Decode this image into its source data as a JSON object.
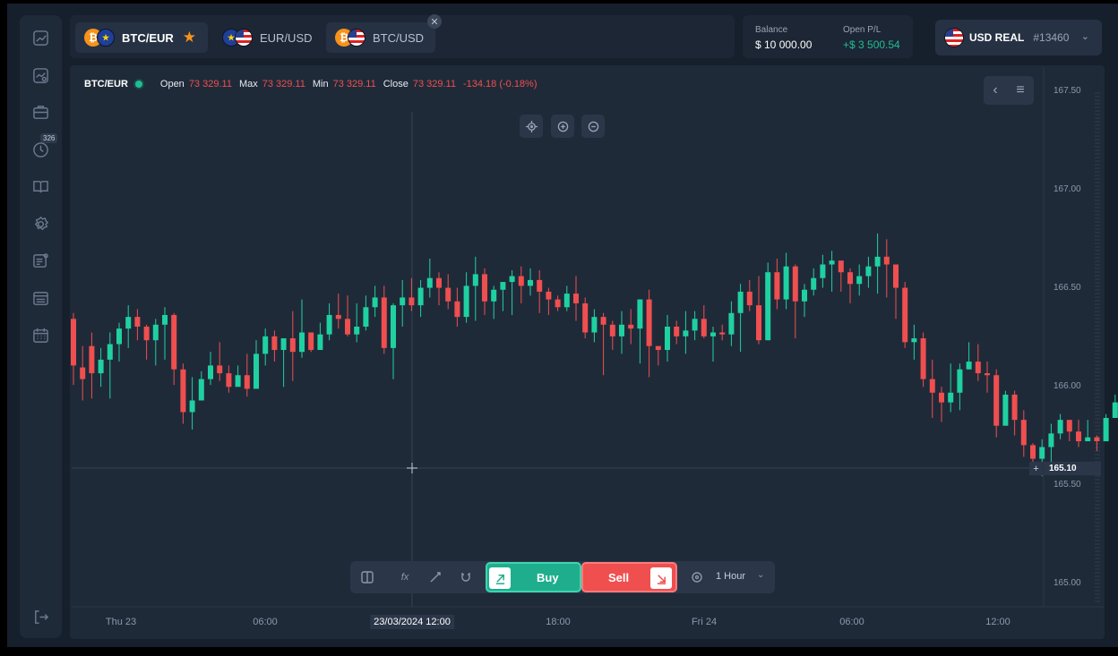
{
  "sidebar": {
    "items": [
      {
        "icon": "analytics-icon"
      },
      {
        "icon": "trade-chart-icon"
      },
      {
        "icon": "portfolio-icon",
        "badge": "326"
      },
      {
        "icon": "history-icon"
      },
      {
        "icon": "education-icon"
      },
      {
        "icon": "settings-icon"
      },
      {
        "icon": "news-icon"
      },
      {
        "icon": "messages-icon"
      },
      {
        "icon": "calendar-icon"
      }
    ],
    "logout_icon": "logout-icon"
  },
  "tabs": [
    {
      "label": "BTC/EUR",
      "active": true,
      "favorite": true
    },
    {
      "label": "EUR/USD",
      "active": false
    },
    {
      "label": "BTC/USD",
      "active": false
    }
  ],
  "balance": {
    "label": "Balance",
    "value": "$ 10 000.00"
  },
  "open_pl": {
    "label": "Open P/L",
    "value": "+$ 3 500.54"
  },
  "account": {
    "type": "USD REAL",
    "id": "#13460"
  },
  "info": {
    "pair": "BTC/EUR",
    "open_label": "Open",
    "open": "73 329.11",
    "max_label": "Max",
    "max": "73 329.11",
    "min_label": "Min",
    "min": "73 329.11",
    "close_label": "Close",
    "close": "73 329.11",
    "change": "-134.18 (-0.18%)"
  },
  "current_price": "165.10",
  "toolbar": {
    "buy": "Buy",
    "sell": "Sell",
    "timeframe": "1 Hour"
  },
  "time_labels": [
    "Thu 23",
    "06:00",
    "23/03/2024 12:00",
    "18:00",
    "Fri 24",
    "06:00",
    "12:00"
  ],
  "price_labels": [
    "167.50",
    "167.00",
    "166.50",
    "166.00",
    "165.50",
    "165.00"
  ],
  "colors": {
    "up": "#1fd1a1",
    "down": "#ef4f4f",
    "bg": "#1f2a39"
  },
  "chart_data": {
    "type": "candlestick",
    "ylim": [
      164.97,
      167.55
    ],
    "candles": [
      [
        166.36,
        166.12,
        166.39,
        166.02
      ],
      [
        166.11,
        166.05,
        166.22,
        165.94
      ],
      [
        166.22,
        166.08,
        166.29,
        165.95
      ],
      [
        166.08,
        166.15,
        166.21,
        166.01
      ],
      [
        166.15,
        166.23,
        166.29,
        165.95
      ],
      [
        166.23,
        166.31,
        166.34,
        166.14
      ],
      [
        166.31,
        166.37,
        166.43,
        166.21
      ],
      [
        166.37,
        166.32,
        166.41,
        166.25
      ],
      [
        166.32,
        166.25,
        166.33,
        166.15
      ],
      [
        166.25,
        166.33,
        166.36,
        166.12
      ],
      [
        166.33,
        166.38,
        166.42,
        166.15
      ],
      [
        166.38,
        166.1,
        166.39,
        166.02
      ],
      [
        166.1,
        165.88,
        166.13,
        165.82
      ],
      [
        165.88,
        165.94,
        166.06,
        165.79
      ],
      [
        165.94,
        166.05,
        166.09,
        165.94
      ],
      [
        166.05,
        166.12,
        166.19,
        166.02
      ],
      [
        166.12,
        166.08,
        166.24,
        166.04
      ],
      [
        166.08,
        166.01,
        166.12,
        165.98
      ],
      [
        166.01,
        166.07,
        166.12,
        166.03
      ],
      [
        166.07,
        166.0,
        166.18,
        165.96
      ],
      [
        166.0,
        166.18,
        166.25,
        166.09
      ],
      [
        166.18,
        166.27,
        166.31,
        166.12
      ],
      [
        166.27,
        166.2,
        166.3,
        166.14
      ],
      [
        166.2,
        166.26,
        166.26,
        166.01
      ],
      [
        166.26,
        166.19,
        166.4,
        166.04
      ],
      [
        166.19,
        166.29,
        166.46,
        166.16
      ],
      [
        166.29,
        166.2,
        166.26,
        166.19
      ],
      [
        166.2,
        166.28,
        166.34,
        166.22
      ],
      [
        166.28,
        166.38,
        166.44,
        166.25
      ],
      [
        166.38,
        166.36,
        166.49,
        166.31
      ],
      [
        166.36,
        166.28,
        166.48,
        166.27
      ],
      [
        166.28,
        166.32,
        166.44,
        166.24
      ],
      [
        166.32,
        166.42,
        166.48,
        166.3
      ],
      [
        166.42,
        166.47,
        166.53,
        166.37
      ],
      [
        166.47,
        166.21,
        166.53,
        166.18
      ],
      [
        166.21,
        166.43,
        166.44,
        166.05
      ],
      [
        166.43,
        166.47,
        166.56,
        166.32
      ],
      [
        166.47,
        166.43,
        166.57,
        166.4
      ],
      [
        166.43,
        166.52,
        166.56,
        166.37
      ],
      [
        166.52,
        166.57,
        166.67,
        166.47
      ],
      [
        166.57,
        166.52,
        166.6,
        166.43
      ],
      [
        166.52,
        166.45,
        166.59,
        166.41
      ],
      [
        166.45,
        166.37,
        166.52,
        166.32
      ],
      [
        166.37,
        166.53,
        166.6,
        166.34
      ],
      [
        166.53,
        166.59,
        166.68,
        166.35
      ],
      [
        166.59,
        166.45,
        166.62,
        166.38
      ],
      [
        166.45,
        166.51,
        166.53,
        166.36
      ],
      [
        166.51,
        166.55,
        166.55,
        166.4
      ],
      [
        166.55,
        166.58,
        166.61,
        166.38
      ],
      [
        166.58,
        166.53,
        166.63,
        166.44
      ],
      [
        166.53,
        166.56,
        166.62,
        166.48
      ],
      [
        166.56,
        166.5,
        166.61,
        166.39
      ],
      [
        166.5,
        166.46,
        166.52,
        166.38
      ],
      [
        166.46,
        166.42,
        166.48,
        166.4
      ],
      [
        166.42,
        166.49,
        166.53,
        166.4
      ],
      [
        166.49,
        166.44,
        166.58,
        166.35
      ],
      [
        166.44,
        166.29,
        166.47,
        166.26
      ],
      [
        166.29,
        166.37,
        166.41,
        166.24
      ],
      [
        166.37,
        166.33,
        166.39,
        166.07
      ],
      [
        166.33,
        166.27,
        166.35,
        166.2
      ],
      [
        166.27,
        166.33,
        166.4,
        166.18
      ],
      [
        166.33,
        166.31,
        166.41,
        166.23
      ],
      [
        166.31,
        166.46,
        166.46,
        166.13
      ],
      [
        166.46,
        166.22,
        166.51,
        166.06
      ],
      [
        166.22,
        166.2,
        166.22,
        166.12
      ],
      [
        166.2,
        166.32,
        166.38,
        166.14
      ],
      [
        166.32,
        166.27,
        166.35,
        166.23
      ],
      [
        166.27,
        166.3,
        166.4,
        166.18
      ],
      [
        166.3,
        166.36,
        166.4,
        166.25
      ],
      [
        166.36,
        166.27,
        166.43,
        166.26
      ],
      [
        166.27,
        166.29,
        166.32,
        166.14
      ],
      [
        166.29,
        166.28,
        166.33,
        166.25
      ],
      [
        166.28,
        166.39,
        166.45,
        166.22
      ],
      [
        166.39,
        166.5,
        166.54,
        166.19
      ],
      [
        166.5,
        166.43,
        166.56,
        166.4
      ],
      [
        166.43,
        166.25,
        166.58,
        166.23
      ],
      [
        166.25,
        166.6,
        166.65,
        166.25
      ],
      [
        166.6,
        166.46,
        166.67,
        166.41
      ],
      [
        166.46,
        166.63,
        166.7,
        166.41
      ],
      [
        166.63,
        166.45,
        166.64,
        166.26
      ],
      [
        166.45,
        166.51,
        166.54,
        166.37
      ],
      [
        166.51,
        166.57,
        166.62,
        166.48
      ],
      [
        166.57,
        166.64,
        166.69,
        166.52
      ],
      [
        166.64,
        166.66,
        166.71,
        166.5
      ],
      [
        166.66,
        166.6,
        166.63,
        166.5
      ],
      [
        166.6,
        166.54,
        166.62,
        166.44
      ],
      [
        166.54,
        166.58,
        166.64,
        166.48
      ],
      [
        166.58,
        166.63,
        166.68,
        166.52
      ],
      [
        166.63,
        166.68,
        166.8,
        166.49
      ],
      [
        166.68,
        166.64,
        166.77,
        166.47
      ],
      [
        166.64,
        166.52,
        166.64,
        166.36
      ],
      [
        166.52,
        166.24,
        166.55,
        166.21
      ],
      [
        166.24,
        166.26,
        166.33,
        166.15
      ],
      [
        166.26,
        166.05,
        166.29,
        166.01
      ],
      [
        166.05,
        165.98,
        166.15,
        165.85
      ],
      [
        165.98,
        165.93,
        166.01,
        165.83
      ],
      [
        165.93,
        165.98,
        166.13,
        165.88
      ],
      [
        165.98,
        166.1,
        166.13,
        165.89
      ],
      [
        166.1,
        166.14,
        166.24,
        166.1
      ],
      [
        166.14,
        166.08,
        166.23,
        166.04
      ],
      [
        166.08,
        166.07,
        166.14,
        165.98
      ],
      [
        166.07,
        165.81,
        166.1,
        165.75
      ],
      [
        165.81,
        165.97,
        165.99,
        165.81
      ],
      [
        165.97,
        165.84,
        165.99,
        165.76
      ],
      [
        165.84,
        165.71,
        165.89,
        165.65
      ],
      [
        165.71,
        165.64,
        165.72,
        165.58
      ],
      [
        165.64,
        165.7,
        165.74,
        165.55
      ],
      [
        165.7,
        165.77,
        165.82,
        165.62
      ],
      [
        165.77,
        165.84,
        165.87,
        165.74
      ],
      [
        165.84,
        165.78,
        165.82,
        165.73
      ],
      [
        165.78,
        165.73,
        165.84,
        165.7
      ],
      [
        165.73,
        165.75,
        165.84,
        165.73
      ],
      [
        165.75,
        165.73,
        165.76,
        165.68
      ],
      [
        165.73,
        165.85,
        165.87,
        165.73
      ],
      [
        165.85,
        165.93,
        165.97,
        165.85
      ],
      [
        165.93,
        166.09,
        166.09,
        165.93
      ]
    ]
  }
}
